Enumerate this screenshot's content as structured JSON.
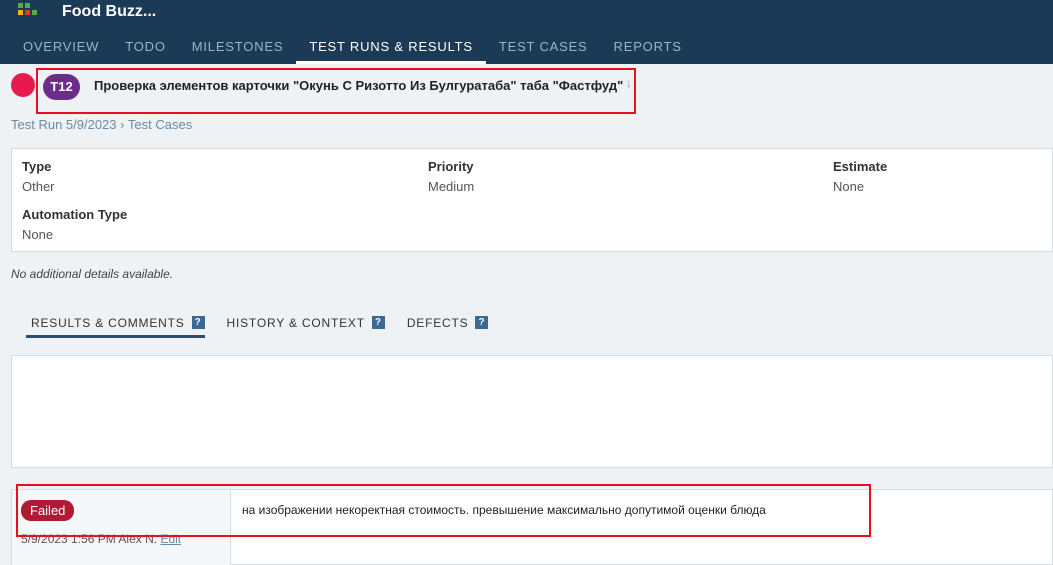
{
  "project": {
    "title": "Food Buzz..."
  },
  "nav": {
    "tabs": [
      {
        "label": "OVERVIEW"
      },
      {
        "label": "TODO"
      },
      {
        "label": "MILESTONES"
      },
      {
        "label": "TEST RUNS & RESULTS"
      },
      {
        "label": "TEST CASES"
      },
      {
        "label": "REPORTS"
      }
    ],
    "active": "TEST RUNS & RESULTS"
  },
  "test": {
    "id": "T12",
    "title": "Проверка элементов карточки \"Окунь С Ризотто Из Булгуратаба\" таба \"Фастфуд\"",
    "status_color": "#e8194f",
    "badge_color": "#6b2d8a"
  },
  "breadcrumb": {
    "run": "Test Run 5/9/2023",
    "separator": "›",
    "section": "Test Cases"
  },
  "properties": {
    "type": {
      "label": "Type",
      "value": "Other"
    },
    "priority": {
      "label": "Priority",
      "value": "Medium"
    },
    "estimate": {
      "label": "Estimate",
      "value": "None"
    },
    "automation_type": {
      "label": "Automation Type",
      "value": "None"
    }
  },
  "no_details_text": "No additional details available.",
  "detail_tabs": [
    {
      "label": "RESULTS & COMMENTS"
    },
    {
      "label": "HISTORY & CONTEXT"
    },
    {
      "label": "DEFECTS"
    }
  ],
  "help_glyph": "?",
  "result": {
    "status": "Failed",
    "status_color": "#b01a34",
    "meta": "5/9/2023 1:56 PM Alex N.",
    "edit_label": "Edit",
    "comment": "на изображении  некоректная стоимость. превышение максимально допутимой оценки блюда"
  }
}
